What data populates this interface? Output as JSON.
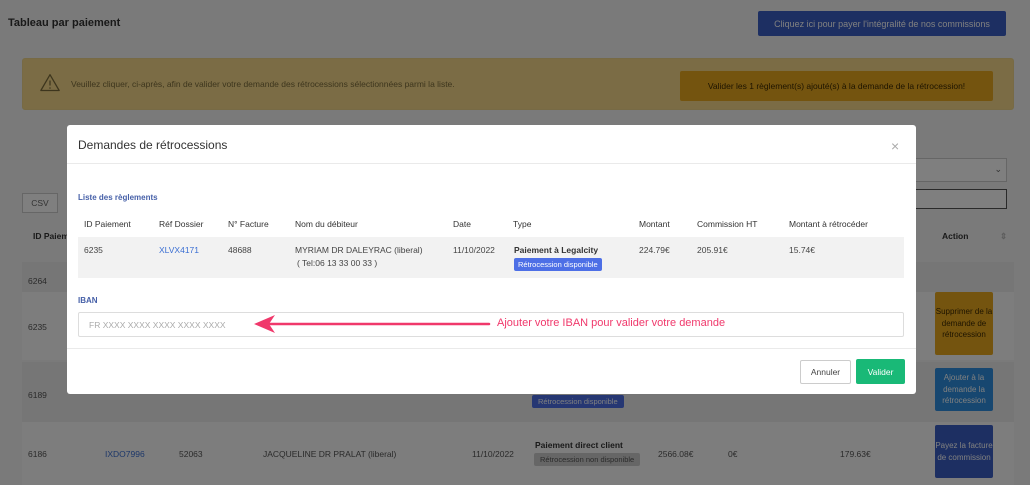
{
  "page": {
    "title": "Tableau par paiement",
    "pay_all_button": "Cliquez ici pour payer l'intégralité de nos commissions",
    "alert": {
      "text": "Veuillez cliquer, ci-après, afin de valider votre demande des rétrocessions sélectionnées parmi la liste.",
      "button": "Valider les 1 règlement(s) ajouté(s) à la demande de la rétrocession!"
    },
    "csv_button": "CSV",
    "table_headers": {
      "id": "ID Paiem",
      "action": "Action"
    },
    "rows": [
      {
        "id": "6264"
      },
      {
        "id": "6235",
        "action": "Supprimer de la demande de rétrocession"
      },
      {
        "id": "6189",
        "badge": "Rétrocession disponible",
        "action": "Ajouter à la demande la rétrocession"
      },
      {
        "id": "6186",
        "ref": "IXDO7996",
        "facture": "52063",
        "debiteur": "JACQUELINE DR PRALAT (liberal)",
        "date": "11/10/2022",
        "type": "Paiement direct client",
        "badge": "Rétrocession non disponible",
        "montant": "2566.08€",
        "commission": "0€",
        "retro": "179.63€",
        "action": "Payez la facture de commission"
      }
    ]
  },
  "modal": {
    "title": "Demandes de rétrocessions",
    "close_icon": "×",
    "section_reglements": "Liste des règlements",
    "headers": [
      "ID Paiement",
      "Réf Dossier",
      "N° Facture",
      "Nom du débiteur",
      "Date",
      "Type",
      "Montant",
      "Commission HT",
      "Montant à rétrocéder"
    ],
    "row": {
      "id": "6235",
      "ref": "XLVX4171",
      "facture": "48688",
      "debiteur": "MYRIAM DR DALEYRAC (liberal)",
      "tel": "( Tel:06 13 33 00 33 )",
      "date": "11/10/2022",
      "type": "Paiement à Legalcity",
      "badge": "Rétrocession disponible",
      "montant": "224.79€",
      "commission": "205.91€",
      "retro": "15.74€"
    },
    "section_iban": "IBAN",
    "iban_placeholder": "FR XXXX XXXX XXXX XXXX XXXX",
    "annotation": "Ajouter votre IBAN pour valider votre demande",
    "cancel_button": "Annuler",
    "submit_button": "Valider"
  },
  "colors": {
    "primary_blue": "#3b5fc4",
    "warning_yellow": "#f6d98a",
    "warning_button": "#e9a81f",
    "success_green": "#19b977",
    "annotation_pink": "#f0386b"
  }
}
